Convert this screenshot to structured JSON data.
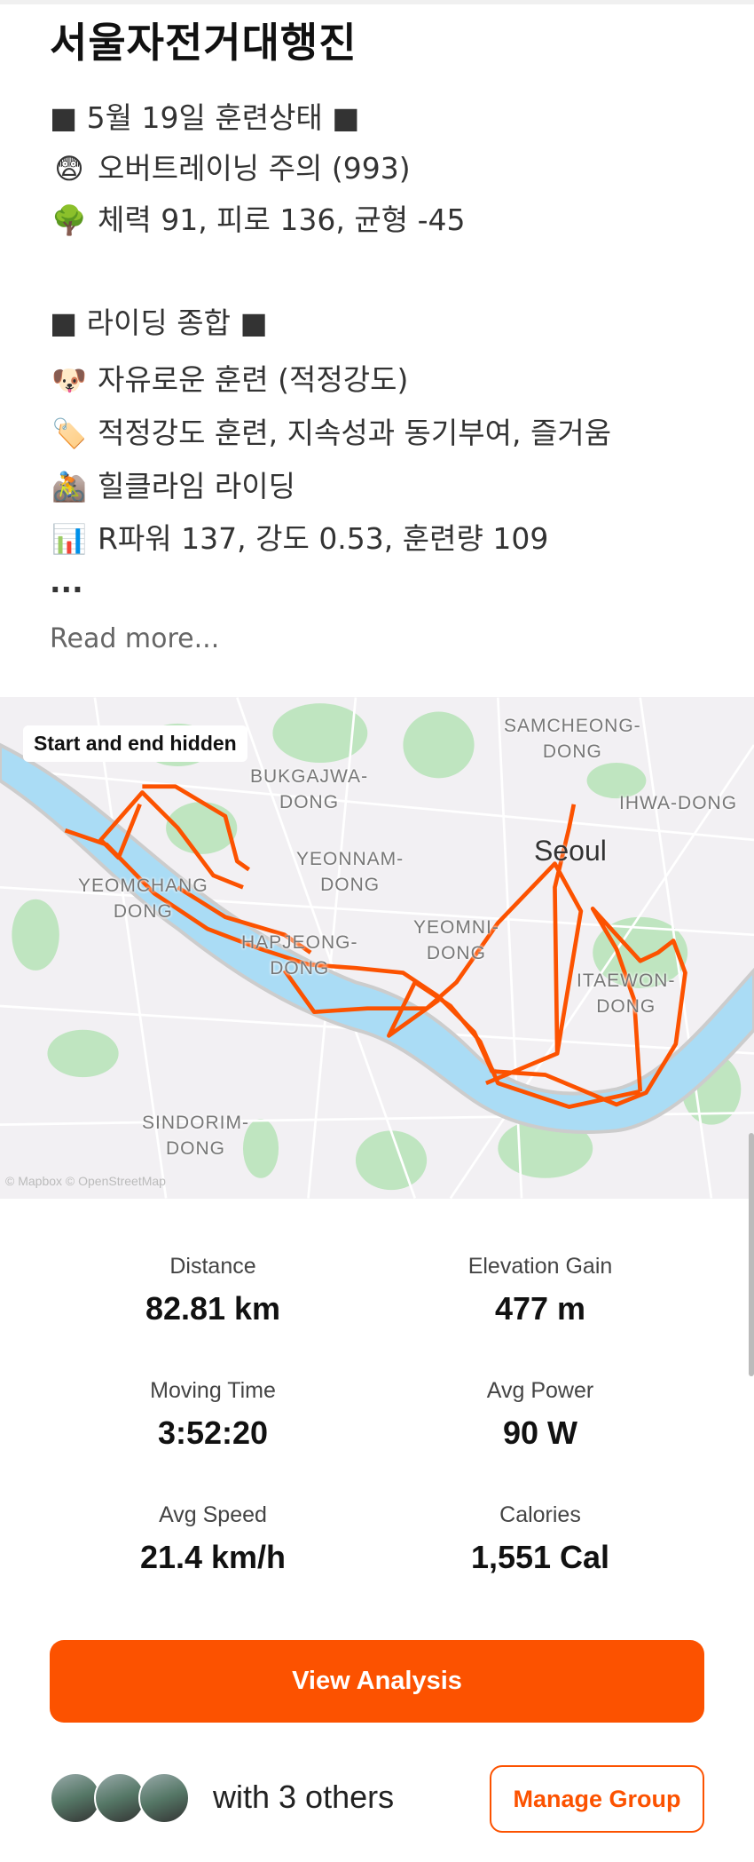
{
  "activity": {
    "title": "서울자전거대행진",
    "description": [
      {
        "icon": "square-bullet",
        "emoji": "",
        "text": "■ 5월 19일 훈련상태 ■"
      },
      {
        "icon": "anxious-face-icon",
        "emoji": "😨",
        "text": "오버트레이닝 주의 (993)"
      },
      {
        "icon": "tree-icon",
        "emoji": "🌳",
        "text": "체력 91, 피로 136, 균형 -45"
      },
      {
        "icon": "square-bullet",
        "emoji": "",
        "text": "■ 라이딩 종합 ■"
      },
      {
        "icon": "dog-face-icon",
        "emoji": "🐶",
        "text": "자유로운 훈련 (적정강도)"
      },
      {
        "icon": "label-tag-icon",
        "emoji": "🏷️",
        "text": "적정강도 훈련, 지속성과 동기부여, 즐거움"
      },
      {
        "icon": "mountain-biker-icon",
        "emoji": "🚵",
        "text": "힐클라임 라이딩"
      },
      {
        "icon": "bar-chart-icon",
        "emoji": "📊",
        "text": "R파워 137, 강도 0.53, 훈련량 109"
      },
      {
        "icon": "",
        "emoji": "",
        "text": "..."
      }
    ],
    "read_more": "Read more..."
  },
  "map": {
    "badge": "Start and end hidden",
    "city": "Seoul",
    "labels": [
      "SAMCHEONG-\nDONG",
      "BUKGAJWA-\nDONG",
      "IHWA-DONG",
      "YEONNAM-\nDONG",
      "YEOMCHANG\nDONG",
      "HAPJEONG-\nDONG",
      "YEOMNI-\nDONG",
      "ITAEWON-\nDONG",
      "SINDORIM-\nDONG"
    ],
    "attribution": "© Mapbox © OpenStreetMap",
    "route_color": "#fc5200",
    "water_color": "#aadcf5",
    "park_color": "#bfe5c0"
  },
  "stats": [
    {
      "label": "Distance",
      "value": "82.81 km"
    },
    {
      "label": "Elevation Gain",
      "value": "477 m"
    },
    {
      "label": "Moving Time",
      "value": "3:52:20"
    },
    {
      "label": "Avg Power",
      "value": "90 W"
    },
    {
      "label": "Avg Speed",
      "value": "21.4 km/h"
    },
    {
      "label": "Calories",
      "value": "1,551 Cal"
    }
  ],
  "actions": {
    "view_analysis": "View Analysis",
    "with_others": "with 3 others",
    "manage_group": "Manage Group"
  },
  "colors": {
    "accent": "#fc5200"
  }
}
